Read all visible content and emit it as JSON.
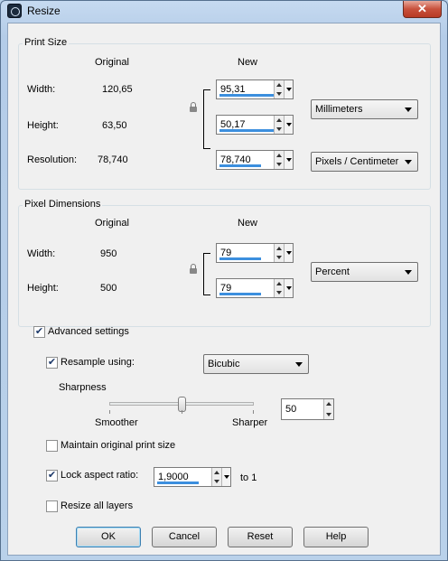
{
  "window": {
    "title": "Resize",
    "close_glyph": "✕"
  },
  "print_size": {
    "group_title": "Print Size",
    "original_header": "Original",
    "new_header": "New",
    "width_label": "Width:",
    "width_original": "120,65",
    "width_new": "95,31",
    "height_label": "Height:",
    "height_original": "63,50",
    "height_new": "50,17",
    "resolution_label": "Resolution:",
    "resolution_original": "78,740",
    "resolution_new": "78,740",
    "units": "Millimeters",
    "resolution_units": "Pixels / Centimeter"
  },
  "pixel_dimensions": {
    "group_title": "Pixel Dimensions",
    "original_header": "Original",
    "new_header": "New",
    "width_label": "Width:",
    "width_original": "950",
    "width_new": "79",
    "height_label": "Height:",
    "height_original": "500",
    "height_new": "79",
    "units": "Percent"
  },
  "advanced": {
    "advanced_settings_label": "Advanced settings",
    "advanced_settings_checked": true,
    "resample_label": "Resample using:",
    "resample_checked": true,
    "resample_method": "Bicubic",
    "sharpness_label": "Sharpness",
    "smoother_label": "Smoother",
    "sharper_label": "Sharper",
    "sharpness_value": "50",
    "maintain_print_size_label": "Maintain original print size",
    "maintain_print_size_checked": false,
    "lock_aspect_label": "Lock aspect ratio:",
    "lock_aspect_checked": true,
    "aspect_value": "1,9000",
    "to_one_label": "to 1",
    "resize_all_layers_label": "Resize all layers",
    "resize_all_layers_checked": false
  },
  "buttons": {
    "ok": "OK",
    "cancel": "Cancel",
    "reset": "Reset",
    "help": "Help"
  },
  "check_glyph": "✔",
  "colors": {
    "titlebar": "#b9d1ea",
    "client_bg": "#f0f0f0",
    "input_underline": "#3c8fde",
    "close_button": "#c8513c"
  }
}
